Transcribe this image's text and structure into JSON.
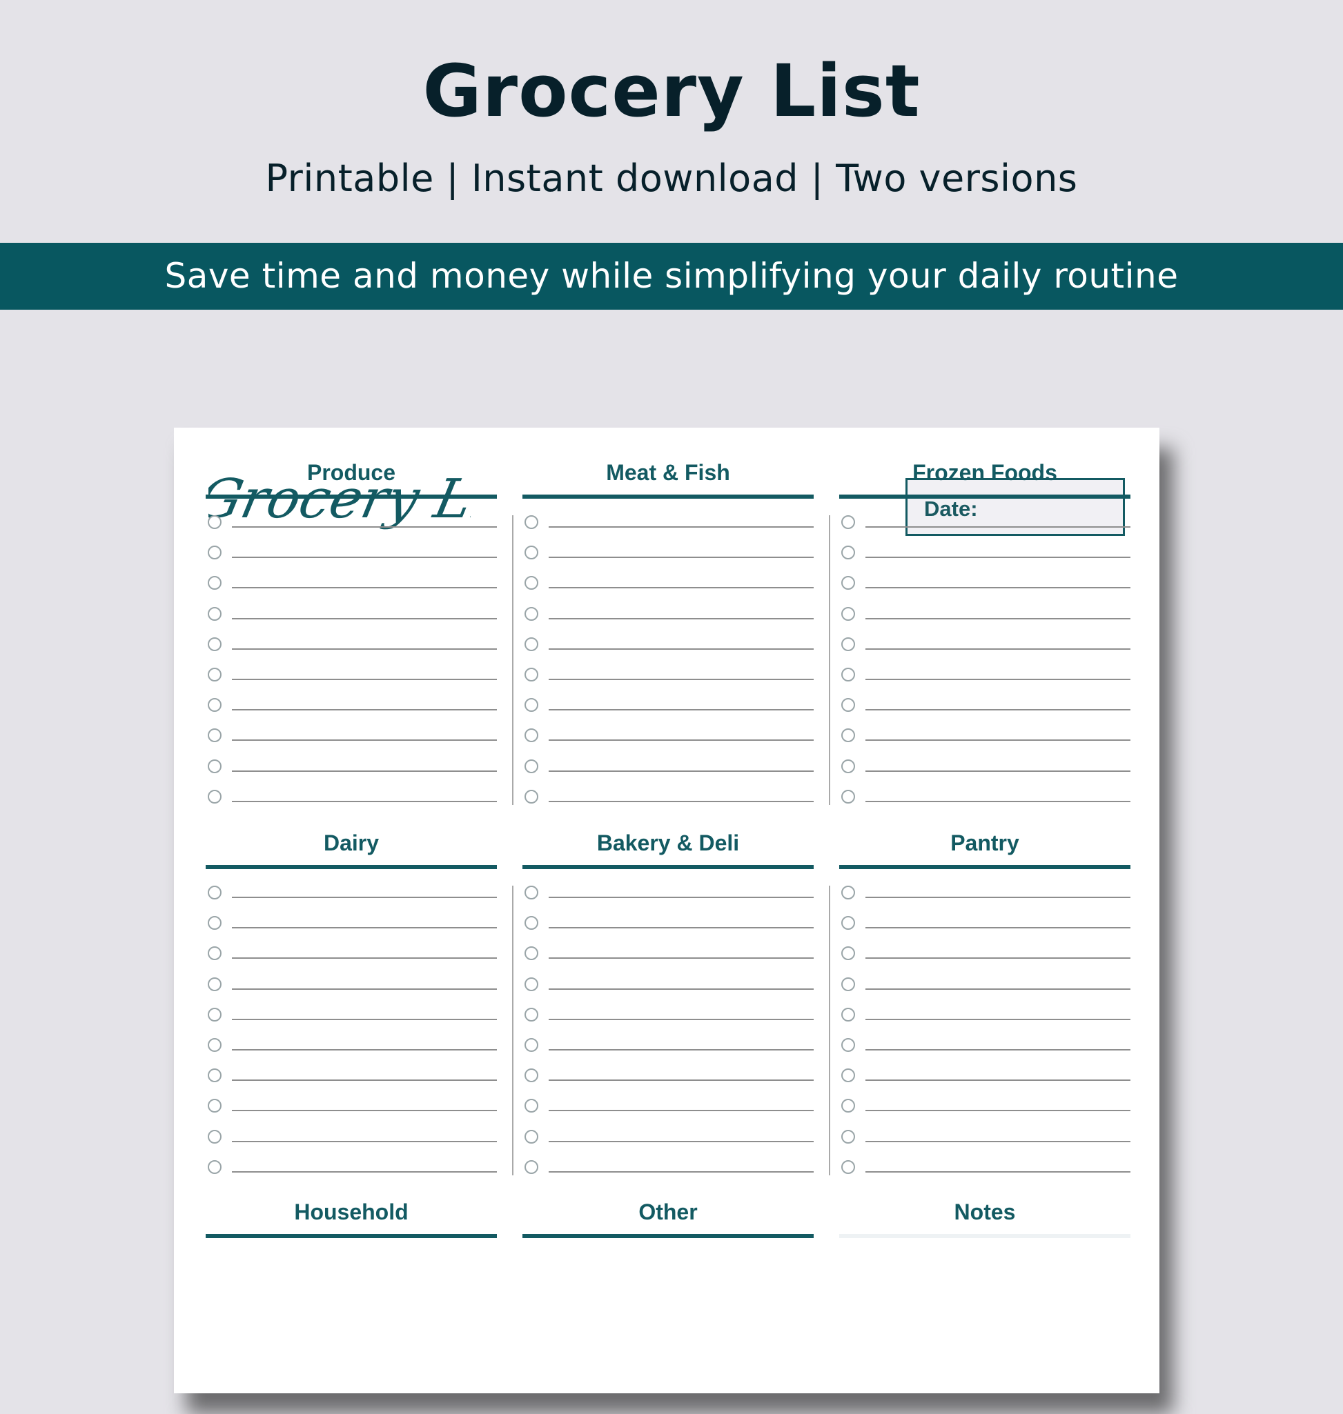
{
  "header": {
    "title": "Grocery List",
    "subtitle": "Printable | Instant download | Two versions"
  },
  "banner": {
    "text": "Save time and money while simplifying your daily routine",
    "color": "#085760"
  },
  "printable": {
    "script_title": "Grocery List",
    "date_label": "Date:",
    "accent_color": "#135a62",
    "sections": [
      {
        "title": "Produce",
        "rows": 10
      },
      {
        "title": "Meat & Fish",
        "rows": 10
      },
      {
        "title": "Frozen Foods",
        "rows": 10
      },
      {
        "title": "Dairy",
        "rows": 10
      },
      {
        "title": "Bakery & Deli",
        "rows": 10
      },
      {
        "title": "Pantry",
        "rows": 10
      },
      {
        "title": "Household",
        "rows": 0
      },
      {
        "title": "Other",
        "rows": 0
      },
      {
        "title": "Notes",
        "rows": 0
      }
    ]
  }
}
